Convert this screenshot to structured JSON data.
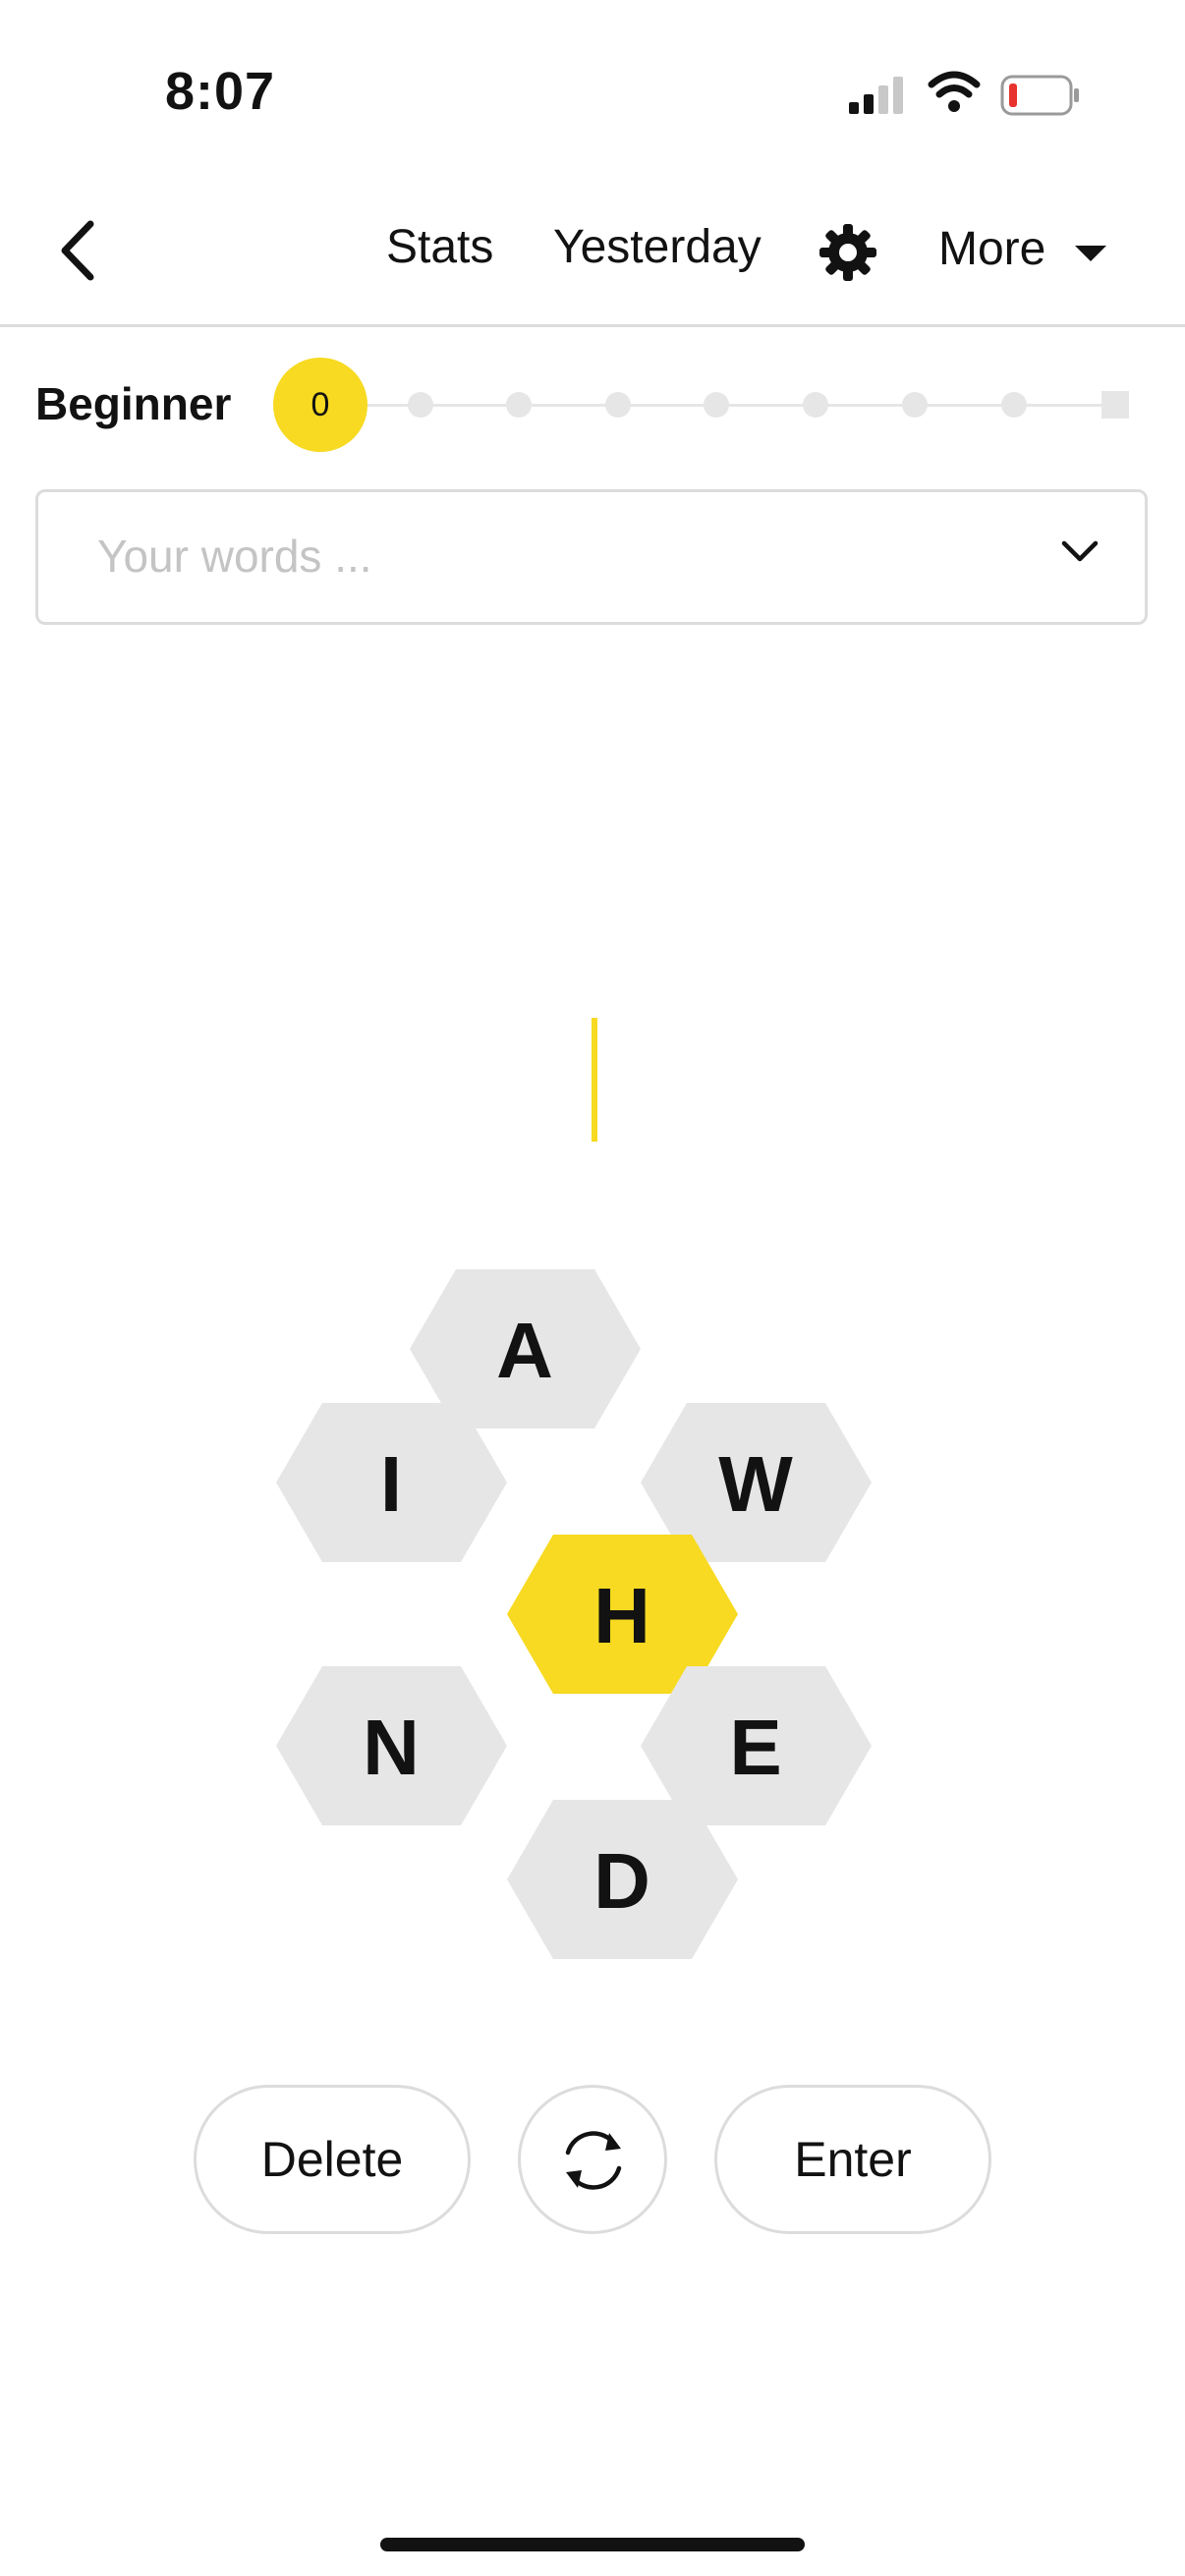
{
  "status_bar": {
    "time": "8:07"
  },
  "nav": {
    "stats": "Stats",
    "yesterday": "Yesterday",
    "more": "More"
  },
  "progress": {
    "rank": "Beginner",
    "score": "0"
  },
  "word_list": {
    "placeholder": "Your words ..."
  },
  "hive": {
    "center": "H",
    "top": "A",
    "upper_left": "I",
    "upper_right": "W",
    "lower_left": "N",
    "lower_right": "E",
    "bottom": "D"
  },
  "controls": {
    "delete": "Delete",
    "enter": "Enter"
  },
  "colors": {
    "accent": "#f7da21",
    "cell": "#e6e6e6",
    "text": "#121212"
  }
}
